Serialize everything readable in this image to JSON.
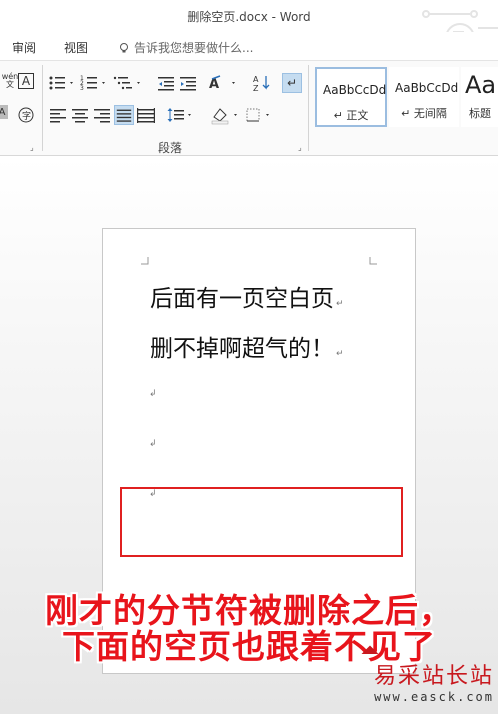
{
  "window": {
    "title": "删除空页.docx - Word"
  },
  "tabs": [
    {
      "label": "审阅"
    },
    {
      "label": "视图"
    }
  ],
  "tell_me": {
    "placeholder": "告诉我您想要做什么..."
  },
  "ribbon": {
    "font_group": {
      "wen_label": "wén\n文",
      "a_label": "A"
    },
    "paragraph_group_label": "段落",
    "styles": [
      {
        "sample": "AaBbCcDd",
        "name": "↵ 正文",
        "selected": true
      },
      {
        "sample": "AaBbCcDd",
        "name": "↵ 无间隔",
        "selected": false
      },
      {
        "sample": "Aa",
        "name": "标题",
        "selected": false
      }
    ]
  },
  "document": {
    "lines": [
      {
        "text": "后面有一页空白页",
        "mark": "↵"
      },
      {
        "text": "删不掉啊超气的！",
        "mark": "↵"
      }
    ],
    "empty_marks": [
      "↲",
      "↲",
      "↲"
    ]
  },
  "caption": {
    "line1": "刚才的分节符被删除之后，",
    "line2": "下面的空页也跟着不见了"
  },
  "watermark": {
    "main": "易采站长站",
    "url": "www.easck.com"
  },
  "colors": {
    "accent_red": "#e02020",
    "ribbon_active": "#c5dcf0"
  }
}
